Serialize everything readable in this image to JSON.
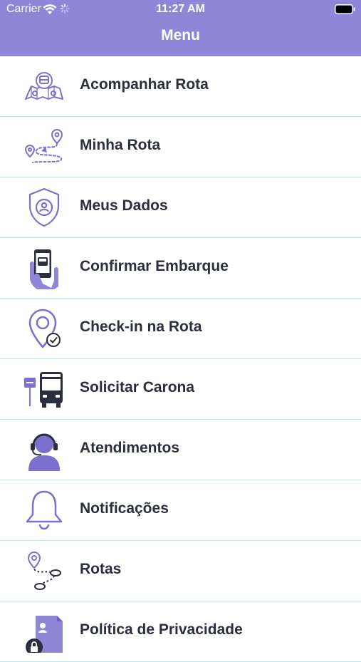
{
  "status_bar": {
    "carrier": "Carrier",
    "time": "11:27 AM"
  },
  "header": {
    "title": "Menu",
    "background_color": "#8f86d8"
  },
  "accent_color": "#7c6fcd",
  "menu": {
    "items": [
      {
        "label": "Acompanhar Rota",
        "icon": "map-route-icon"
      },
      {
        "label": "Minha Rota",
        "icon": "route-path-icon"
      },
      {
        "label": "Meus Dados",
        "icon": "user-shield-icon"
      },
      {
        "label": "Confirmar Embarque",
        "icon": "phone-bus-icon"
      },
      {
        "label": "Check-in na Rota",
        "icon": "location-check-icon"
      },
      {
        "label": "Solicitar Carona",
        "icon": "bus-stop-icon"
      },
      {
        "label": "Atendimentos",
        "icon": "headset-agent-icon"
      },
      {
        "label": "Notificações",
        "icon": "bell-icon"
      },
      {
        "label": "Rotas",
        "icon": "routes-pin-icon"
      },
      {
        "label": "Política de Privacidade",
        "icon": "privacy-document-icon"
      }
    ]
  }
}
